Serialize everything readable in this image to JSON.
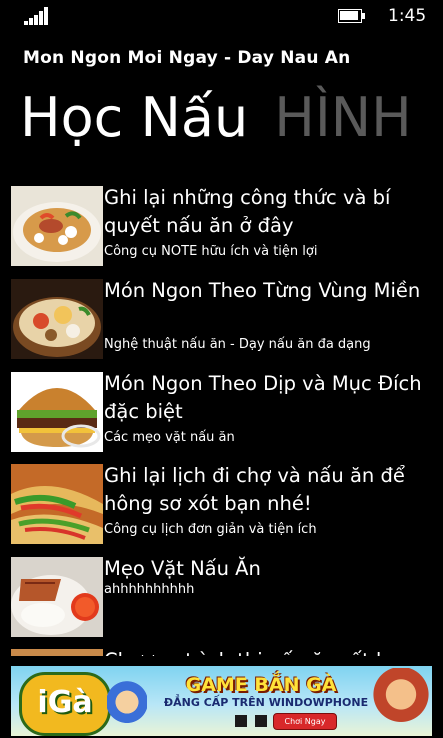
{
  "status": {
    "time": "1:45",
    "signal_icon": "signal-strength-icon",
    "battery_icon": "battery-charging-icon"
  },
  "app": {
    "title": "Mon Ngon Moi Ngay - Day Nau An"
  },
  "pivot": {
    "active": "Học Nấu",
    "next": "HÌNH"
  },
  "list": {
    "items": [
      {
        "title": "Ghi lại những công thức và bí quyết nấu ăn ở đây",
        "subtitle": "Công cụ NOTE hữu ích và tiện lợi",
        "thumb": "noodle-bowl-image"
      },
      {
        "title": "Món Ngon Theo Từng Vùng Miền",
        "subtitle": "Nghệ thuật nấu ăn - Dạy nấu ăn đa dạng",
        "thumb": "hotpot-image"
      },
      {
        "title": "Món Ngon Theo Dịp và Mục Đích đặc biệt",
        "subtitle": "Các mẹo vặt nấu ăn",
        "thumb": "burger-image"
      },
      {
        "title": "Ghi lại lịch đi chợ và nấu ăn để hông sơ xót bạn nhé!",
        "subtitle": "Công cụ lịch đơn giản và tiện ích",
        "thumb": "tacos-image"
      },
      {
        "title": "Mẹo Vặt Nấu Ăn",
        "subtitle": "ahhhhhhhhhh",
        "thumb": "rice-plate-image"
      },
      {
        "title": "Chương trình thi nấu ăn rất hay",
        "subtitle": "",
        "thumb": "cooking-show-image"
      }
    ]
  },
  "ad": {
    "logo": "iGà",
    "headline": "GAME BẮN GÀ",
    "tagline": "ĐẲNG CẤP TRÊN WINDOWPHONE",
    "button": "Chơi Ngay"
  }
}
